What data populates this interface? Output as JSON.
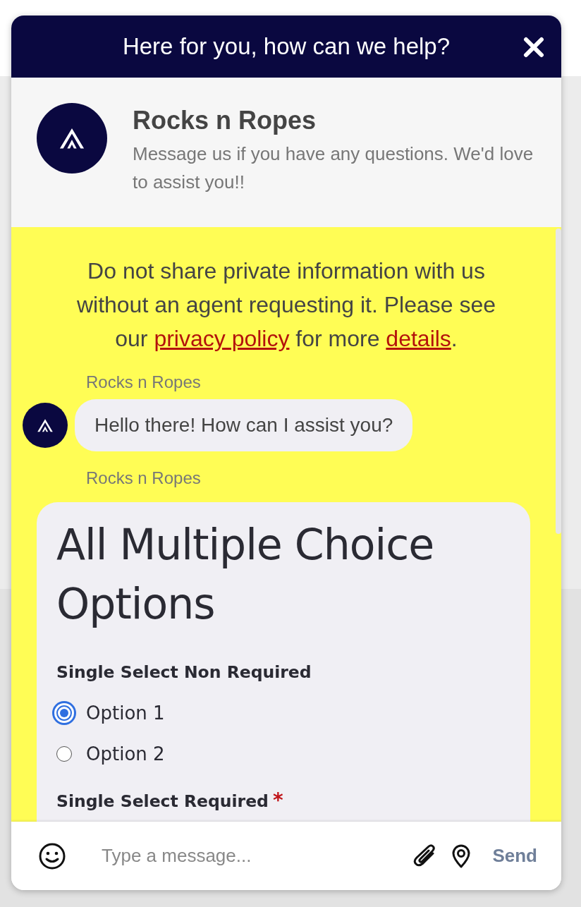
{
  "header": {
    "title": "Here for you, how can we help?"
  },
  "profile": {
    "name": "Rocks n Ropes",
    "description": "Message us if you have any questions. We'd love to assist you!!"
  },
  "notice": {
    "parts": [
      {
        "kind": "text",
        "text": "Do not share private information with us without an agent requesting it. Please see our "
      },
      {
        "kind": "link",
        "text": "privacy policy"
      },
      {
        "kind": "text",
        "text": " for more "
      },
      {
        "kind": "link",
        "text": "details"
      },
      {
        "kind": "text",
        "text": "."
      }
    ]
  },
  "messages": [
    {
      "kind": "text",
      "sender": "Rocks n Ropes",
      "text": "Hello there! How can I assist you?"
    },
    {
      "kind": "form",
      "sender": "Rocks n Ropes",
      "title": "All Multiple Choice Options",
      "required_mark": "*",
      "questions": [
        {
          "label": "Single Select Non Required",
          "required": false,
          "options": [
            {
              "label": "Option 1",
              "selected": true
            },
            {
              "label": "Option 2",
              "selected": false
            }
          ]
        },
        {
          "label": "Single Select Required",
          "required": true
        }
      ]
    }
  ],
  "composer": {
    "placeholder": "Type a message...",
    "send": "Send"
  }
}
